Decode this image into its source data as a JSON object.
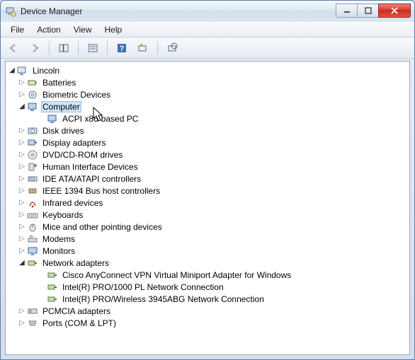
{
  "window": {
    "title": "Device Manager"
  },
  "menu": {
    "file": "File",
    "action": "Action",
    "view": "View",
    "help": "Help"
  },
  "root": {
    "name": "Lincoln"
  },
  "computer": {
    "label": "Computer",
    "child": "ACPI x86-based PC"
  },
  "network": {
    "label": "Network adapters",
    "items": [
      "Cisco AnyConnect VPN Virtual Miniport Adapter for Windows",
      "Intel(R) PRO/1000 PL Network Connection",
      "Intel(R) PRO/Wireless 3945ABG Network Connection"
    ]
  },
  "cats": {
    "batteries": "Batteries",
    "biometric": "Biometric Devices",
    "disk": "Disk drives",
    "display": "Display adapters",
    "dvd": "DVD/CD-ROM drives",
    "hid": "Human Interface Devices",
    "ide": "IDE ATA/ATAPI controllers",
    "ieee1394": "IEEE 1394 Bus host controllers",
    "infrared": "Infrared devices",
    "keyboards": "Keyboards",
    "mice": "Mice and other pointing devices",
    "modems": "Modems",
    "monitors": "Monitors",
    "pcmcia": "PCMCIA adapters",
    "ports": "Ports (COM & LPT)"
  }
}
